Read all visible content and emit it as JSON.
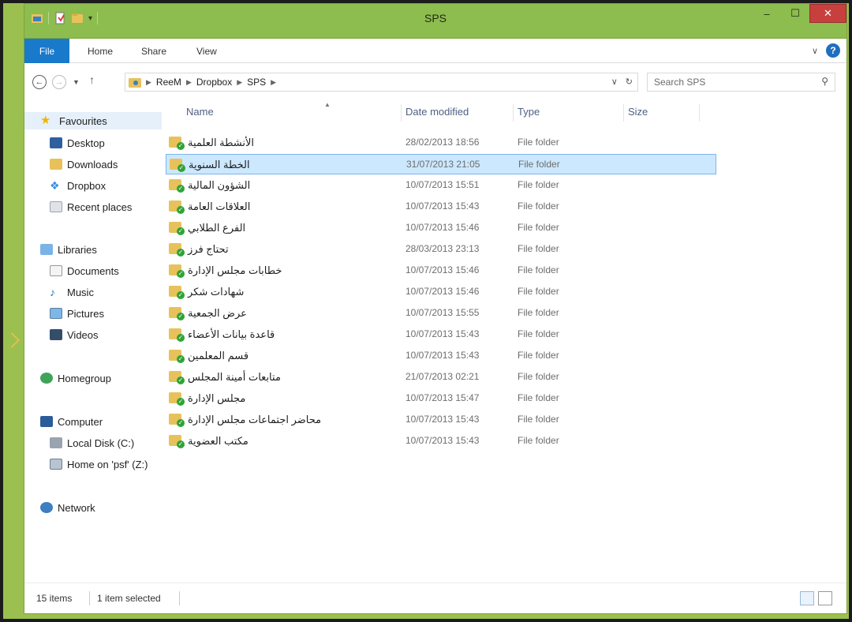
{
  "window": {
    "title": "SPS"
  },
  "ribbon": {
    "tabs": [
      "File",
      "Home",
      "Share",
      "View"
    ]
  },
  "address": {
    "crumbs": [
      "ReeM",
      "Dropbox",
      "SPS"
    ]
  },
  "search": {
    "placeholder": "Search SPS"
  },
  "sidebar": {
    "favourites": "Favourites",
    "fav_items": [
      "Desktop",
      "Downloads",
      "Dropbox",
      "Recent places"
    ],
    "libraries": "Libraries",
    "lib_items": [
      "Documents",
      "Music",
      "Pictures",
      "Videos"
    ],
    "homegroup": "Homegroup",
    "computer": "Computer",
    "comp_items": [
      "Local Disk (C:)",
      "Home on 'psf' (Z:)"
    ],
    "network": "Network"
  },
  "columns": {
    "name": "Name",
    "date": "Date modified",
    "type": "Type",
    "size": "Size"
  },
  "files": [
    {
      "name": "الأنشطة العلمية",
      "date": "28/02/2013 18:56",
      "type": "File folder"
    },
    {
      "name": "الخطة السنوية",
      "date": "31/07/2013 21:05",
      "type": "File folder",
      "selected": true
    },
    {
      "name": "الشؤون المالية",
      "date": "10/07/2013 15:51",
      "type": "File folder"
    },
    {
      "name": "العلاقات العامة",
      "date": "10/07/2013 15:43",
      "type": "File folder"
    },
    {
      "name": "الفرع الطلابي",
      "date": "10/07/2013 15:46",
      "type": "File folder"
    },
    {
      "name": "تحتاج فرز",
      "date": "28/03/2013 23:13",
      "type": "File folder"
    },
    {
      "name": "خطابات مجلس الإدارة",
      "date": "10/07/2013 15:46",
      "type": "File folder"
    },
    {
      "name": "شهادات شكر",
      "date": "10/07/2013 15:46",
      "type": "File folder"
    },
    {
      "name": "عرض الجمعية",
      "date": "10/07/2013 15:55",
      "type": "File folder"
    },
    {
      "name": "قاعدة بيانات الأعضاء",
      "date": "10/07/2013 15:43",
      "type": "File folder"
    },
    {
      "name": "قسم المعلمين",
      "date": "10/07/2013 15:43",
      "type": "File folder"
    },
    {
      "name": "متابعات أمينة المجلس",
      "date": "21/07/2013 02:21",
      "type": "File folder"
    },
    {
      "name": "مجلس الإدارة",
      "date": "10/07/2013 15:47",
      "type": "File folder"
    },
    {
      "name": "محاضر اجتماعات مجلس الإدارة",
      "date": "10/07/2013 15:43",
      "type": "File folder"
    },
    {
      "name": "مكتب العضوية",
      "date": "10/07/2013 15:43",
      "type": "File folder"
    }
  ],
  "status": {
    "count": "15 items",
    "selection": "1 item selected"
  },
  "colors": {
    "titlebar": "#8dbc4f",
    "file_tab": "#1979ca",
    "close": "#c7403d",
    "selection": "#cce8ff"
  }
}
